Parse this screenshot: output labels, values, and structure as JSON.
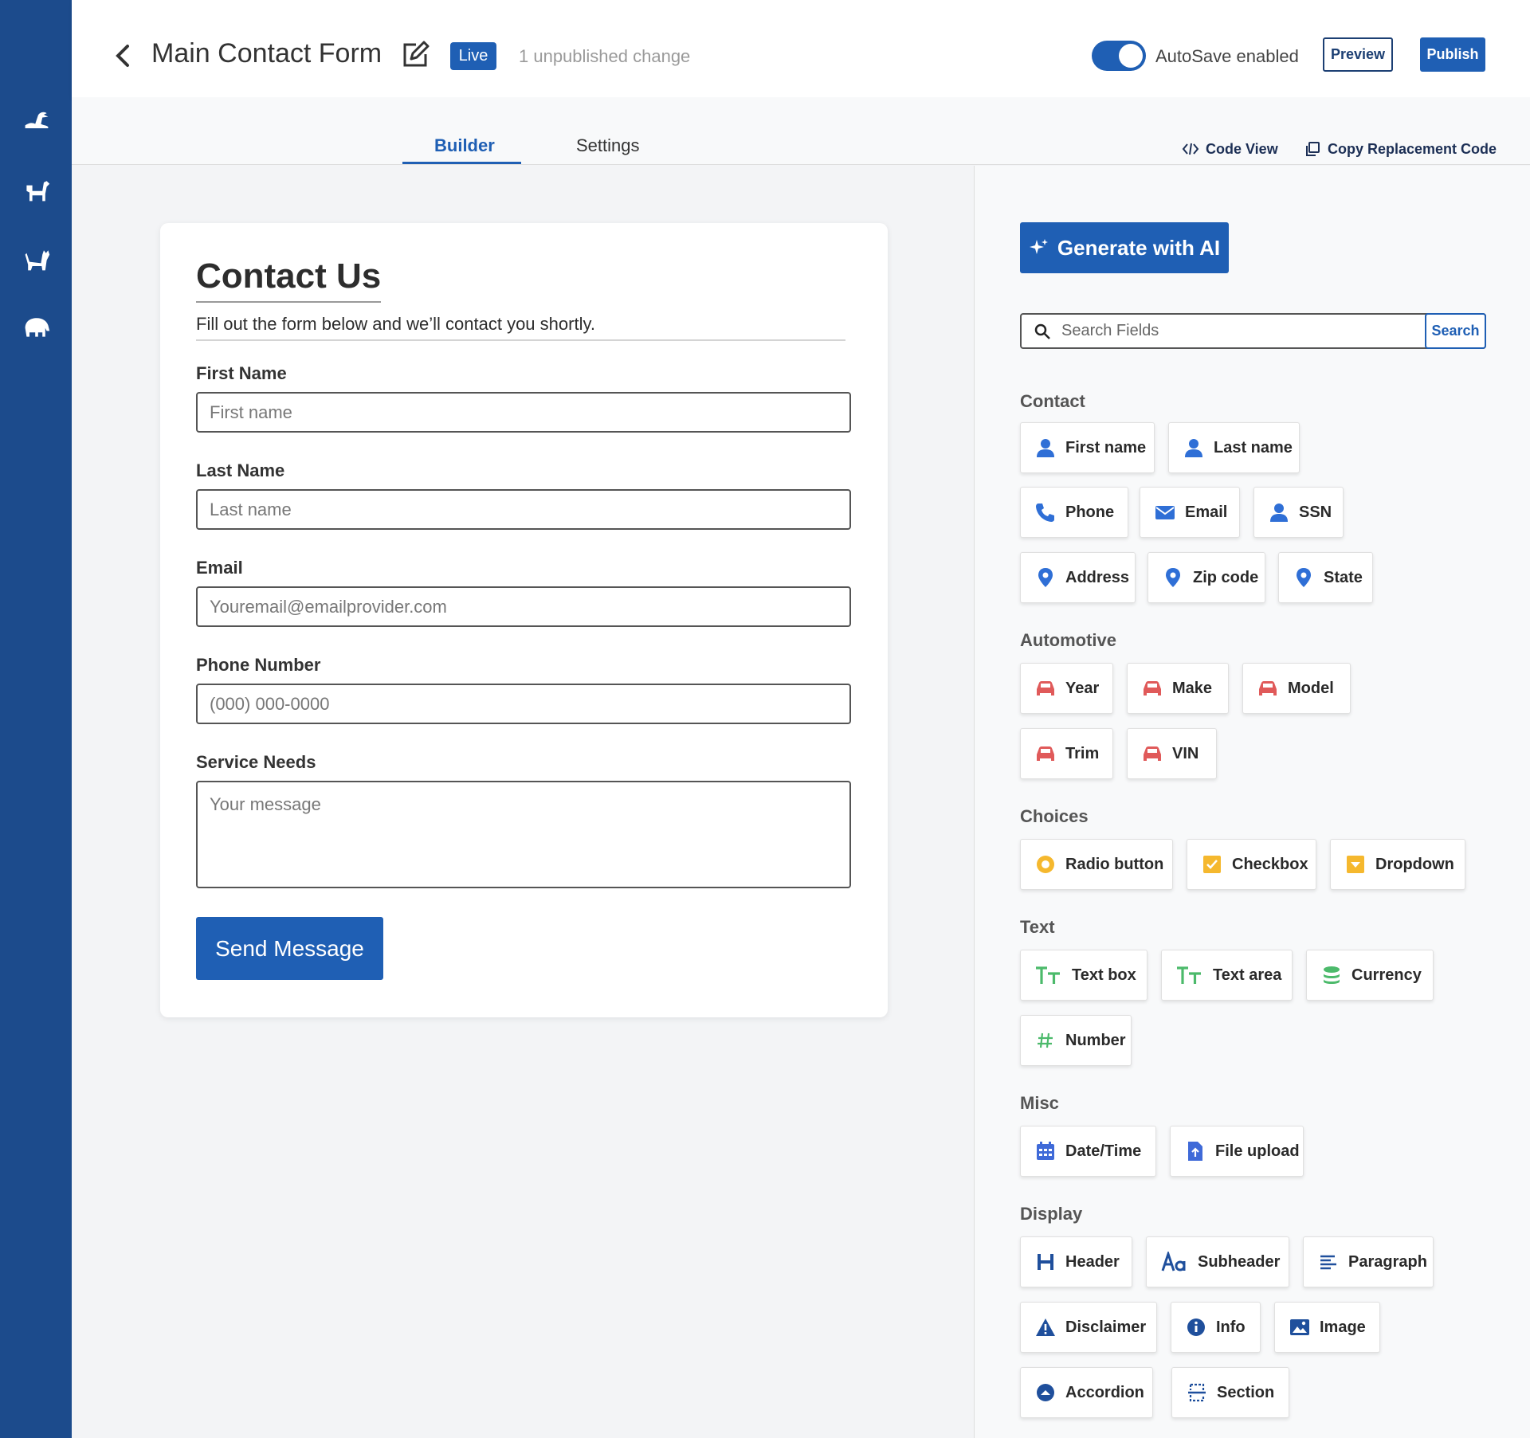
{
  "header": {
    "title": "Main Contact Form",
    "status_badge": "Live",
    "unpublished": "1 unpublished change",
    "autosave_label": "AutoSave enabled",
    "preview_label": "Preview",
    "publish_label": "Publish"
  },
  "tabs": {
    "builder": "Builder",
    "settings": "Settings",
    "code_view": "Code View",
    "copy_code": "Copy Replacement Code"
  },
  "form": {
    "title": "Contact Us",
    "subtitle": "Fill out the form below and we’ll contact you shortly.",
    "fields": [
      {
        "label": "First Name",
        "placeholder": "First name"
      },
      {
        "label": "Last Name",
        "placeholder": "Last name"
      },
      {
        "label": "Email",
        "placeholder": "Youremail@emailprovider.com"
      },
      {
        "label": "Phone Number",
        "placeholder": "(000) 000-0000"
      },
      {
        "label": "Service Needs",
        "placeholder": "Your message"
      }
    ],
    "submit_label": "Send Message"
  },
  "panel": {
    "ai_label": "Generate with AI",
    "search_placeholder": "Search Fields",
    "search_button": "Search",
    "categories": {
      "contact": "Contact",
      "automotive": "Automotive",
      "choices": "Choices",
      "text": "Text",
      "misc": "Misc",
      "display": "Display"
    },
    "chips": {
      "first_name": "First name",
      "last_name": "Last name",
      "phone": "Phone",
      "email": "Email",
      "ssn": "SSN",
      "address": "Address",
      "zip": "Zip code",
      "state": "State",
      "year": "Year",
      "make": "Make",
      "model": "Model",
      "trim": "Trim",
      "vin": "VIN",
      "radio": "Radio button",
      "checkbox": "Checkbox",
      "dropdown": "Dropdown",
      "textbox": "Text box",
      "textarea": "Text area",
      "currency": "Currency",
      "number": "Number",
      "datetime": "Date/Time",
      "file": "File upload",
      "header": "Header",
      "subheader": "Subheader",
      "paragraph": "Paragraph",
      "disclaimer": "Disclaimer",
      "info": "Info",
      "image": "Image",
      "accordion": "Accordion",
      "section": "Section"
    }
  },
  "colors": {
    "brand_blue": "#1f5fb4",
    "rail": "#1c4b8c",
    "auto_red": "#e05a5a",
    "choice_yellow": "#f5b82e",
    "text_green": "#4cba6b"
  }
}
